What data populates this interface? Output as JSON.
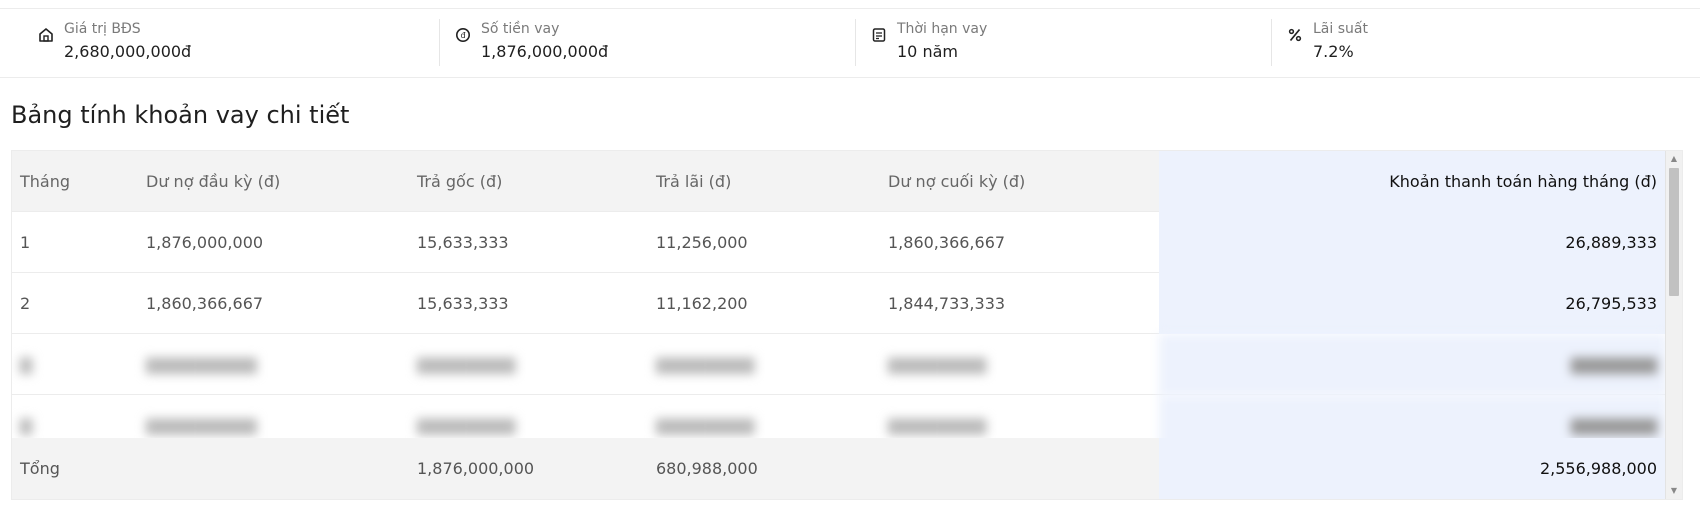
{
  "summary": {
    "items": [
      {
        "icon": "house-icon",
        "label": "Giá trị BĐS",
        "value": "2,680,000,000đ"
      },
      {
        "icon": "coin-icon",
        "label": "Số tiền vay",
        "value": "1,876,000,000đ"
      },
      {
        "icon": "calendar-icon",
        "label": "Thời hạn vay",
        "value": "10 năm"
      },
      {
        "icon": "percent-icon",
        "label": "Lãi suất",
        "value": "7.2%"
      }
    ]
  },
  "table": {
    "title": "Bảng tính khoản vay chi tiết",
    "headers": [
      "Tháng",
      "Dư nợ đầu kỳ (đ)",
      "Trả gốc (đ)",
      "Trả lãi (đ)",
      "Dư nợ cuối kỳ (đ)",
      "Khoản thanh toán hàng tháng (đ)"
    ],
    "rows": [
      [
        "1",
        "1,876,000,000",
        "15,633,333",
        "11,256,000",
        "1,860,366,667",
        "26,889,333"
      ],
      [
        "2",
        "1,860,366,667",
        "15,633,333",
        "11,162,200",
        "1,844,733,333",
        "26,795,533"
      ]
    ],
    "total": {
      "label": "Tổng",
      "principal": "1,876,000,000",
      "interest": "680,988,000",
      "payment": "2,556,988,000"
    }
  },
  "colors": {
    "accent_column": "#edf2fd",
    "header_bg": "#f3f3f3"
  }
}
